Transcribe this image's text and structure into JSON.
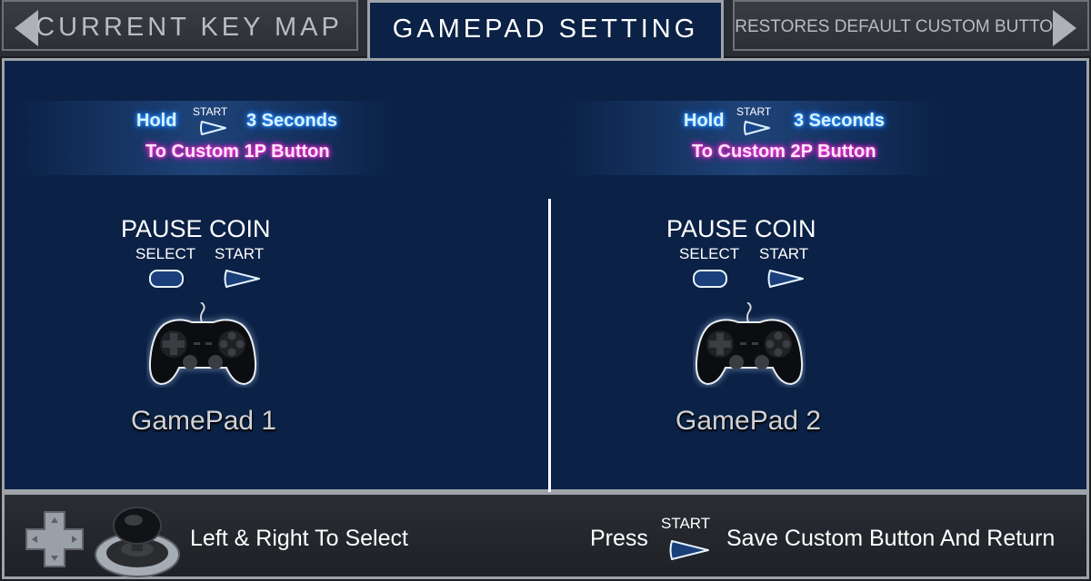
{
  "tabs": {
    "left": {
      "label": "CURRENT KEY MAP"
    },
    "active": {
      "label": "GAMEPAD SETTING"
    },
    "right": {
      "label": "RESTORES DEFAULT CUSTOM BUTTON"
    }
  },
  "players": [
    {
      "hold_label": "Hold",
      "start_label": "START",
      "seconds_label": "3 Seconds",
      "custom_label": "To Custom 1P Button",
      "pause_coin": "PAUSE COIN",
      "select_label": "SELECT",
      "start_small": "START",
      "gamepad_name": "GamePad 1"
    },
    {
      "hold_label": "Hold",
      "start_label": "START",
      "seconds_label": "3 Seconds",
      "custom_label": "To Custom 2P Button",
      "pause_coin": "PAUSE COIN",
      "select_label": "SELECT",
      "start_small": "START",
      "gamepad_name": "GamePad 2"
    }
  ],
  "footer": {
    "select_hint": "Left & Right To Select",
    "press_label": "Press",
    "start_label": "START",
    "save_hint": "Save Custom Button And Return"
  },
  "icons": {
    "tab_left_arrow": "chevron-left-icon",
    "tab_right_arrow": "chevron-right-icon",
    "start_button": "start-button-icon",
    "select_button": "select-button-icon",
    "gamepad": "gamepad-icon",
    "dpad": "dpad-icon",
    "joystick": "joystick-icon"
  },
  "colors": {
    "panel_bg": "#0b2146",
    "hold_glow": "#1f7bff",
    "custom_glow": "#e01fc5",
    "border": "#9ea3aa"
  }
}
